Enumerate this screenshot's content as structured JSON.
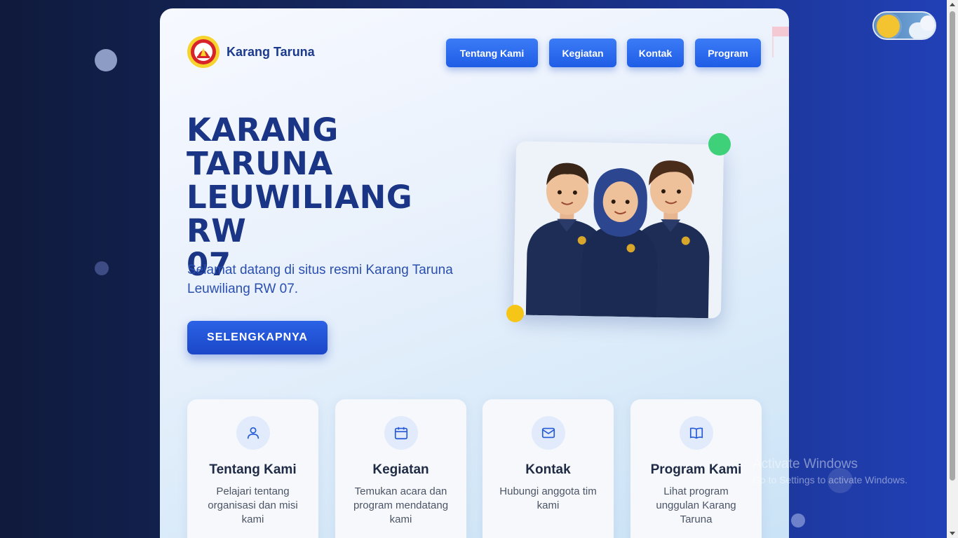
{
  "header": {
    "brand": "Karang Taruna",
    "logo_icon": "karang-taruna-emblem",
    "nav": [
      {
        "label": "Tentang Kami"
      },
      {
        "label": "Kegiatan"
      },
      {
        "label": "Kontak"
      },
      {
        "label": "Program"
      }
    ]
  },
  "hero": {
    "title_lines": [
      "KARANG",
      "TARUNA",
      "LEUWILIANG RW",
      "07"
    ],
    "subtitle": "Selamat datang di situs resmi Karang Taruna Leuwiliang RW 07.",
    "cta_label": "SELENGKAPNYA",
    "image_icon": "three-members-illustration"
  },
  "features": [
    {
      "icon": "user-icon",
      "title": "Tentang Kami",
      "desc": "Pelajari tentang organisasi dan misi kami"
    },
    {
      "icon": "calendar-icon",
      "title": "Kegiatan",
      "desc": "Temukan acara dan program mendatang kami"
    },
    {
      "icon": "mail-icon",
      "title": "Kontak",
      "desc": "Hubungi anggota tim kami"
    },
    {
      "icon": "book-icon",
      "title": "Program Kami",
      "desc": "Lihat program unggulan Karang Taruna"
    }
  ],
  "theme_toggle": {
    "state": "light",
    "icon": "sun-cloud-toggle"
  },
  "watermark": {
    "line1": "Activate Windows",
    "line2": "Go to Settings to activate Windows."
  },
  "colors": {
    "primary": "#1f5de6",
    "heading": "#1a3585",
    "accent_green": "#3fd07a",
    "accent_yellow": "#f5c518"
  }
}
